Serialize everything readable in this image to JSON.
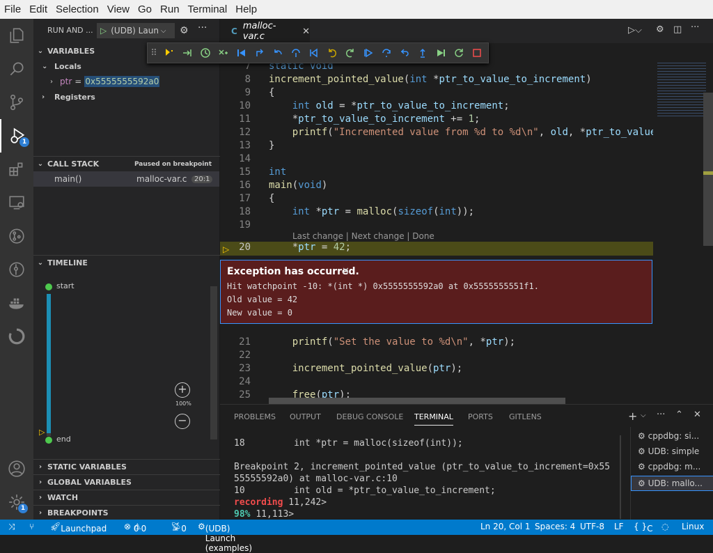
{
  "menubar": [
    "File",
    "Edit",
    "Selection",
    "View",
    "Go",
    "Run",
    "Terminal",
    "Help"
  ],
  "activity": {
    "debug_badge": "1",
    "accounts_badge": "1"
  },
  "sidebar": {
    "title": "RUN AND ...",
    "launch_config": "(UDB) Laun",
    "variables": {
      "header": "VARIABLES",
      "locals": "Locals",
      "ptr_name": "ptr",
      "ptr_eq": "=",
      "ptr_value": "0x5555555592a0",
      "registers": "Registers"
    },
    "call_stack": {
      "header": "CALL STACK",
      "status": "Paused on breakpoint",
      "frame": "main()",
      "file": "malloc-var.c",
      "pos": "20:1"
    },
    "timeline": {
      "header": "TIMELINE",
      "start": "start",
      "end": "end",
      "zoom": "100%",
      "progress": 0.98
    },
    "sections": [
      "STATIC VARIABLES",
      "GLOBAL VARIABLES",
      "WATCH",
      "BREAKPOINTS"
    ]
  },
  "editor": {
    "tab": "malloc-var.c",
    "tab_icon": "C",
    "codelens": "Last change | Next change | Done",
    "lines": [
      {
        "n": "7",
        "html": "<span class='kw'>static</span> <span class='kw'>void</span>"
      },
      {
        "n": "8",
        "html": "<span class='fn'>increment_pointed_value</span>(<span class='kw'>int</span> *<span class='var'>ptr_to_value_to_increment</span>)"
      },
      {
        "n": "9",
        "html": "{"
      },
      {
        "n": "10",
        "html": "    <span class='kw'>int</span> <span class='var'>old</span> = *<span class='var'>ptr_to_value_to_increment</span>;"
      },
      {
        "n": "11",
        "html": "    *<span class='var'>ptr_to_value_to_increment</span> += <span class='num'>1</span>;"
      },
      {
        "n": "12",
        "html": "    <span class='fn'>printf</span>(<span class='str'>\"Incremented value from %d to %d\\n\"</span>, <span class='var'>old</span>, *<span class='var'>ptr_to_value</span>"
      },
      {
        "n": "13",
        "html": "}"
      },
      {
        "n": "14",
        "html": ""
      },
      {
        "n": "15",
        "html": "<span class='kw'>int</span>"
      },
      {
        "n": "16",
        "html": "<span class='fn'>main</span>(<span class='kw'>void</span>)"
      },
      {
        "n": "17",
        "html": "{"
      },
      {
        "n": "18",
        "html": "    <span class='kw'>int</span> *<span class='var'>ptr</span> = <span class='fn'>malloc</span>(<span class='kw'>sizeof</span>(<span class='kw'>int</span>));"
      },
      {
        "n": "19",
        "html": ""
      },
      {
        "n": "20",
        "html": "    *<span class='var'>ptr</span> = <span class='num'>42</span>;"
      },
      {
        "n": "21",
        "html": "    <span class='fn'>printf</span>(<span class='str'>\"Set the value to %d\\n\"</span>, *<span class='var'>ptr</span>);"
      },
      {
        "n": "22",
        "html": ""
      },
      {
        "n": "23",
        "html": "    <span class='fn'>increment_pointed_value</span>(<span class='var'>ptr</span>);"
      },
      {
        "n": "24",
        "html": ""
      },
      {
        "n": "25",
        "html": "    <span class='fn'>free</span>(<span class='var'>ptr</span>);"
      }
    ]
  },
  "exception": {
    "title": "Exception has occurred.",
    "line1": "Hit watchpoint -10: *(int *) 0x5555555592a0 at 0x5555555551f1.",
    "line2": "Old value = 42",
    "line3": "New value = 0"
  },
  "panel": {
    "tabs": [
      "PROBLEMS",
      "OUTPUT",
      "DEBUG CONSOLE",
      "TERMINAL",
      "PORTS",
      "GITLENS"
    ],
    "active_tab": "TERMINAL",
    "term_lines": [
      "18         int *ptr = malloc(sizeof(int));",
      "",
      "Breakpoint 2, increment_pointed_value (ptr_to_value_to_increment=0x55",
      "55555592a0) at malloc-var.c:10",
      "10         int old = *ptr_to_value_to_increment;"
    ],
    "recording_label": "recording",
    "recording_value": "11,242>",
    "progress_label": "98%",
    "progress_value": "11,113>",
    "terminals": [
      "cppdbg: si...",
      "UDB: simple",
      "cppdbg: m...",
      "UDB: mallo..."
    ]
  },
  "status": {
    "launchpad": "Launchpad",
    "errors": "0",
    "warnings": "0",
    "ports": "0",
    "launch": "(UDB) Launch (examples)",
    "position": "Ln 20, Col 1",
    "spaces": "Spaces: 4",
    "encoding": "UTF-8",
    "eol": "LF",
    "lang": "C",
    "os": "Linux"
  },
  "colors": {
    "accent": "#007acc",
    "exception_bg": "#5a1d1d",
    "current_line": "#4b4b18",
    "breakpoint": "#ffcc00"
  }
}
